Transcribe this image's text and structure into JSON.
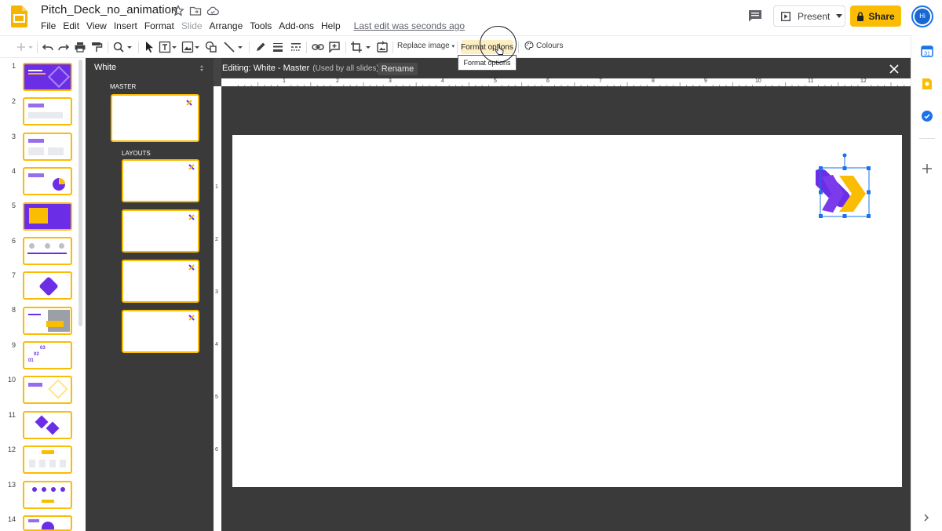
{
  "header": {
    "doc_title": "Pitch_Deck_no_animation",
    "menu": [
      "File",
      "Edit",
      "View",
      "Insert",
      "Format",
      "Slide",
      "Arrange",
      "Tools",
      "Add-ons",
      "Help"
    ],
    "disabled_menu": "Slide",
    "last_edit": "Last edit was seconds ago",
    "present_label": "Present",
    "share_label": "Share",
    "avatar_initials": "Hi"
  },
  "toolbar": {
    "replace_image": "Replace image",
    "format_options": "Format options",
    "colours": "Colours",
    "tooltip": "Format options"
  },
  "filmstrip": {
    "slide_numbers": [
      "1",
      "2",
      "3",
      "4",
      "5",
      "6",
      "7",
      "8",
      "9",
      "10",
      "11",
      "12",
      "13",
      "14"
    ],
    "active_slide": 1
  },
  "layouts_panel": {
    "title": "White",
    "master_label": "MASTER",
    "layouts_label": "LAYOUTS"
  },
  "editor": {
    "editing_title": "Editing: White - Master",
    "editing_sub": "(Used by all slides)",
    "rename_label": "Rename",
    "ruler_h": [
      "1",
      "2",
      "3",
      "4",
      "5",
      "6",
      "7",
      "8",
      "9",
      "10",
      "11",
      "12"
    ],
    "ruler_v": [
      "1",
      "2",
      "3",
      "4",
      "5",
      "6"
    ]
  },
  "colors": {
    "accent_yellow": "#fbbc04",
    "brand_purple": "#6b2ee6",
    "selection_blue": "#1a73e8",
    "editor_dark": "#3a3a3a"
  }
}
